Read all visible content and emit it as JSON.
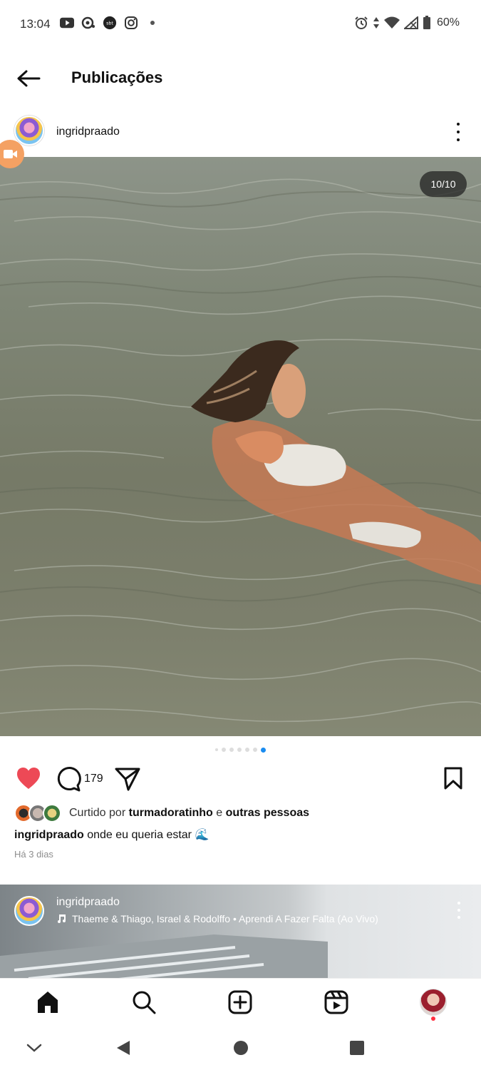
{
  "status_bar": {
    "time": "13:04",
    "battery": "60%",
    "icons_left": [
      "youtube-icon",
      "podcast-icon",
      "sbt-icon",
      "instagram-icon",
      "dot-icon"
    ],
    "icons_right": [
      "alarm-icon",
      "data-arrows-icon",
      "wifi-icon",
      "signal-icon",
      "battery-icon"
    ]
  },
  "header": {
    "title": "Publicações"
  },
  "post": {
    "username": "ingridpraado",
    "counter": "10/10",
    "comment_count": "179",
    "likes_prefix": "Curtido por",
    "likes_user": "turmadoratinho",
    "likes_joiner": "e",
    "likes_others": "outras pessoas",
    "caption_user": "ingridpraado",
    "caption_text": "onde eu queria estar 🌊",
    "time_ago": "Há 3 dias",
    "carousel_total": 7,
    "carousel_active": 7
  },
  "next_post": {
    "username": "ingridpraado",
    "music": "Thaeme & Thiago, Israel & Rodolffo • Aprendi A Fazer Falta (Ao Vivo)"
  },
  "bottom_nav": [
    "home-icon",
    "search-icon",
    "create-icon",
    "reels-icon",
    "profile-avatar"
  ],
  "colors": {
    "like": "#ed4956",
    "active_dot": "#1a8cf0",
    "notification": "#ff3040"
  }
}
